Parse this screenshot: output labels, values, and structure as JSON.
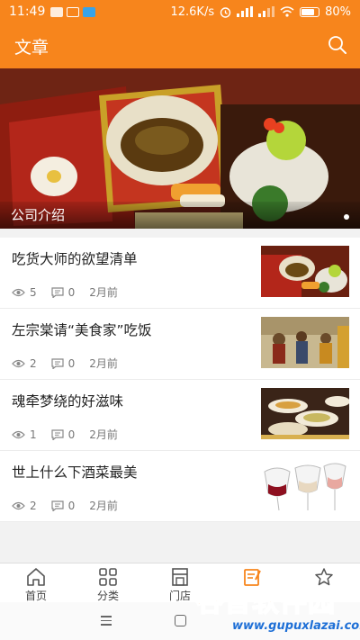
{
  "status_bar": {
    "time": "11:49",
    "network_speed": "12.6K/s",
    "battery": "80%",
    "battery_level": 0.8
  },
  "header": {
    "title": "文章"
  },
  "banner": {
    "caption": "公司介绍"
  },
  "articles": [
    {
      "title": "吃货大师的欲望清单",
      "views": "5",
      "comments": "0",
      "time": "2月前"
    },
    {
      "title": "左宗棠请“美食家”吃饭",
      "views": "2",
      "comments": "0",
      "time": "2月前"
    },
    {
      "title": "魂牵梦绕的好滋味",
      "views": "1",
      "comments": "0",
      "time": "2月前"
    },
    {
      "title": "世上什么下酒菜最美",
      "views": "2",
      "comments": "0",
      "time": "2月前"
    }
  ],
  "tabs": [
    {
      "label": "首页"
    },
    {
      "label": "分类"
    },
    {
      "label": "门店"
    },
    {
      "label": ""
    },
    {
      "label": ""
    }
  ],
  "watermark": {
    "brand": "谷普软件园",
    "url": "www.gupuxlazai.com"
  },
  "colors": {
    "accent": "#f7851c",
    "watermark_orange": "#ff8a1a",
    "watermark_blue": "#1e6fd6"
  }
}
